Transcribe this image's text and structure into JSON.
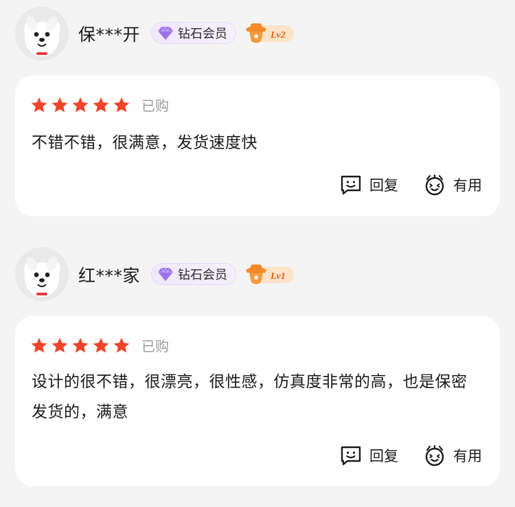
{
  "colors": {
    "background": "#f4f4f4",
    "card": "#ffffff",
    "star": "#f0442a",
    "muted_text": "#9a9a9a",
    "member_badge_bg": "#efe8fb",
    "gem": "#9b72e8",
    "level_badge": "#f28a2a"
  },
  "reviews": [
    {
      "username": "保***开",
      "member_label": "钻石会员",
      "member_icon": "diamond-icon",
      "level": "Lv2",
      "rating": 5,
      "bought_label": "已购",
      "text": "不错不错，很满意，发货速度快",
      "reply_label": "回复",
      "useful_label": "有用"
    },
    {
      "username": "红***家",
      "member_label": "钻石会员",
      "member_icon": "diamond-icon",
      "level": "Lv1",
      "rating": 5,
      "bought_label": "已购",
      "text": "设计的很不错，很漂亮，很性感，仿真度非常的高，也是保密发货的，满意",
      "reply_label": "回复",
      "useful_label": "有用"
    }
  ]
}
